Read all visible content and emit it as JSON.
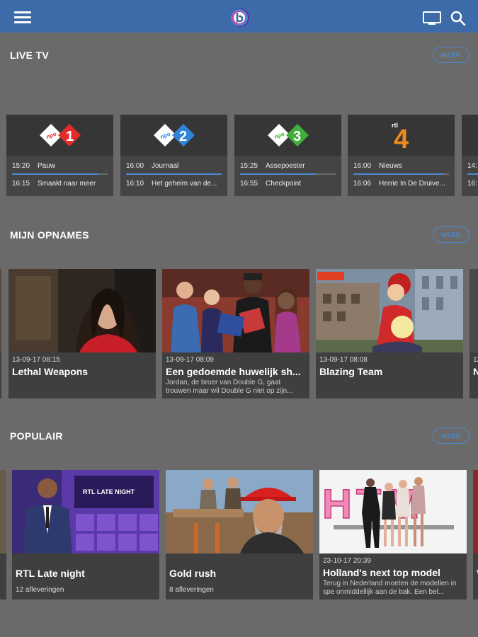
{
  "topbar": {
    "menu_icon": "hamburger-menu-icon",
    "logo": "app-logo-icon",
    "cast_icon": "tv-icon",
    "search_icon": "search-icon",
    "accent": "#3d6aa8"
  },
  "sections": {
    "live_tv": {
      "title": "LIVE TV",
      "more": "MEER"
    },
    "recordings": {
      "title": "MIJN OPNAMES",
      "more": "MEER"
    },
    "popular": {
      "title": "POPULAIR",
      "more": "MEER"
    }
  },
  "channels": [
    {
      "logo_text": "npo 1",
      "now_time": "15:20",
      "now_title": "Pauw",
      "next_time": "16:15",
      "next_title": "Smaakt naar meer",
      "progress": 0.9,
      "color": "#e22b2b"
    },
    {
      "logo_text": "npo 2",
      "now_time": "16:00",
      "now_title": "Journaal",
      "next_time": "16:10",
      "next_title": "Het geheim van de...",
      "progress": 1.0,
      "color": "#2f86d8"
    },
    {
      "logo_text": "npo 3",
      "now_time": "15:25",
      "now_title": "Assepoester",
      "next_time": "16:55",
      "next_title": "Checkpoint",
      "progress": 0.8,
      "color": "#3fae3a"
    },
    {
      "logo_text": "rtl 4",
      "now_time": "16:00",
      "now_title": "Nieuws",
      "next_time": "16:06",
      "next_title": "Herrie In De Druive...",
      "progress": 0.95,
      "color": "#f08a1c"
    },
    {
      "logo_text": "",
      "now_time": "14:",
      "now_title": "",
      "next_time": "16:",
      "next_title": "",
      "progress": 0.5,
      "color": "#888"
    }
  ],
  "recordings": [
    {
      "date": "13-09-17 08:15",
      "title": "Lethal Weapons",
      "description": ""
    },
    {
      "date": "13-09-17 08:09",
      "title": "Een gedoemde huwelijk sh...",
      "description": "Jordan, de broer van Double G, gaat trouwen maar wil Double G niet op zijn..."
    },
    {
      "date": "13-09-17 08:08",
      "title": "Blazing Team",
      "description": ""
    },
    {
      "date": "12",
      "title": "N",
      "description": ""
    }
  ],
  "popular": [
    {
      "title": "RTL Late night",
      "subtitle": "12 afleveringen",
      "date": "",
      "description": ""
    },
    {
      "title": "Gold rush",
      "subtitle": "8 afleveringen",
      "date": "",
      "description": ""
    },
    {
      "title": "Holland's next top model",
      "subtitle": "",
      "date": "23-10-17 20:39",
      "description": "Terug in Nederland moeten de modellen in spe onmiddellijk aan de bak. Een bel..."
    },
    {
      "title": "V",
      "subtitle": "",
      "date": "",
      "description": ""
    }
  ],
  "thumb_texts": {
    "rtl_late_night": "RTL LATE NIGHT",
    "htm": "HTM"
  }
}
